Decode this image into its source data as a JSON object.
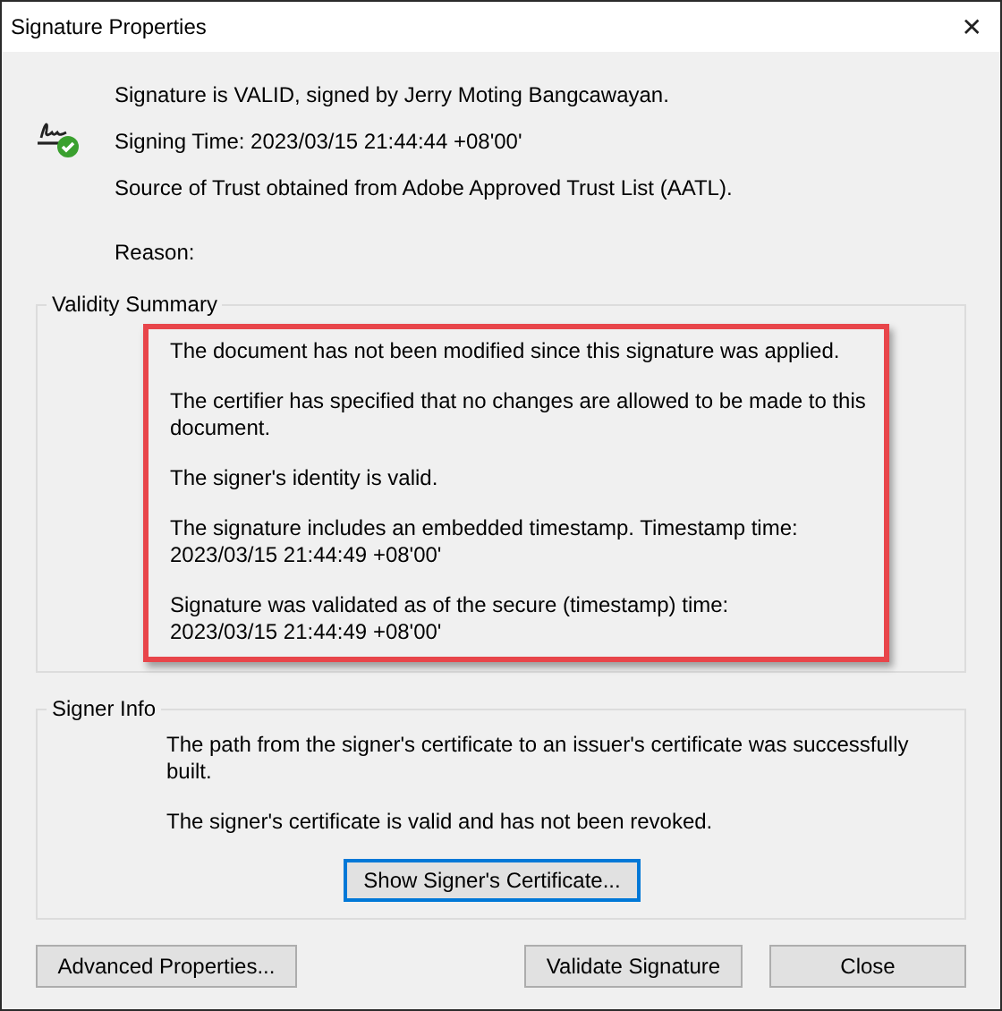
{
  "window": {
    "title": "Signature Properties",
    "close": "✕"
  },
  "header": {
    "lines": [
      {
        "label": "Signature is VALID, signed by Jerry Moting Bangcawayan."
      },
      {
        "label": "Signing Time:  2023/03/15 21:44:44 +08'00'"
      },
      {
        "label": "Source of Trust obtained from Adobe Approved Trust List (AATL)."
      },
      {
        "label": "Reason:"
      }
    ]
  },
  "validity_summary": {
    "title": "Validity Summary",
    "highlighted": true,
    "paragraphs": [
      {
        "lines": [
          "The document has not been modified since this signature was applied."
        ]
      },
      {
        "lines": [
          "The certifier has specified that no changes are allowed to be made to this",
          "document."
        ]
      },
      {
        "lines": [
          "The signer's identity is valid."
        ]
      },
      {
        "lines": [
          "The signature includes an embedded timestamp. Timestamp time:",
          "2023/03/15 21:44:49 +08'00'"
        ]
      },
      {
        "lines": [
          "Signature was validated as of the secure (timestamp) time:",
          "2023/03/15 21:44:49 +08'00'"
        ]
      }
    ]
  },
  "signer_info": {
    "title": "Signer Info",
    "paragraphs": [
      {
        "lines": [
          "The path from the signer's certificate to an issuer's certificate was successfully",
          "built."
        ]
      },
      {
        "lines": [
          "The signer's certificate is valid and has not been revoked."
        ]
      }
    ],
    "button": {
      "label": "Show Signer's Certificate...",
      "focused": true
    }
  },
  "buttons": [
    {
      "label": "Advanced Properties..."
    },
    {
      "label": "Validate Signature"
    },
    {
      "label": "Close"
    }
  ]
}
